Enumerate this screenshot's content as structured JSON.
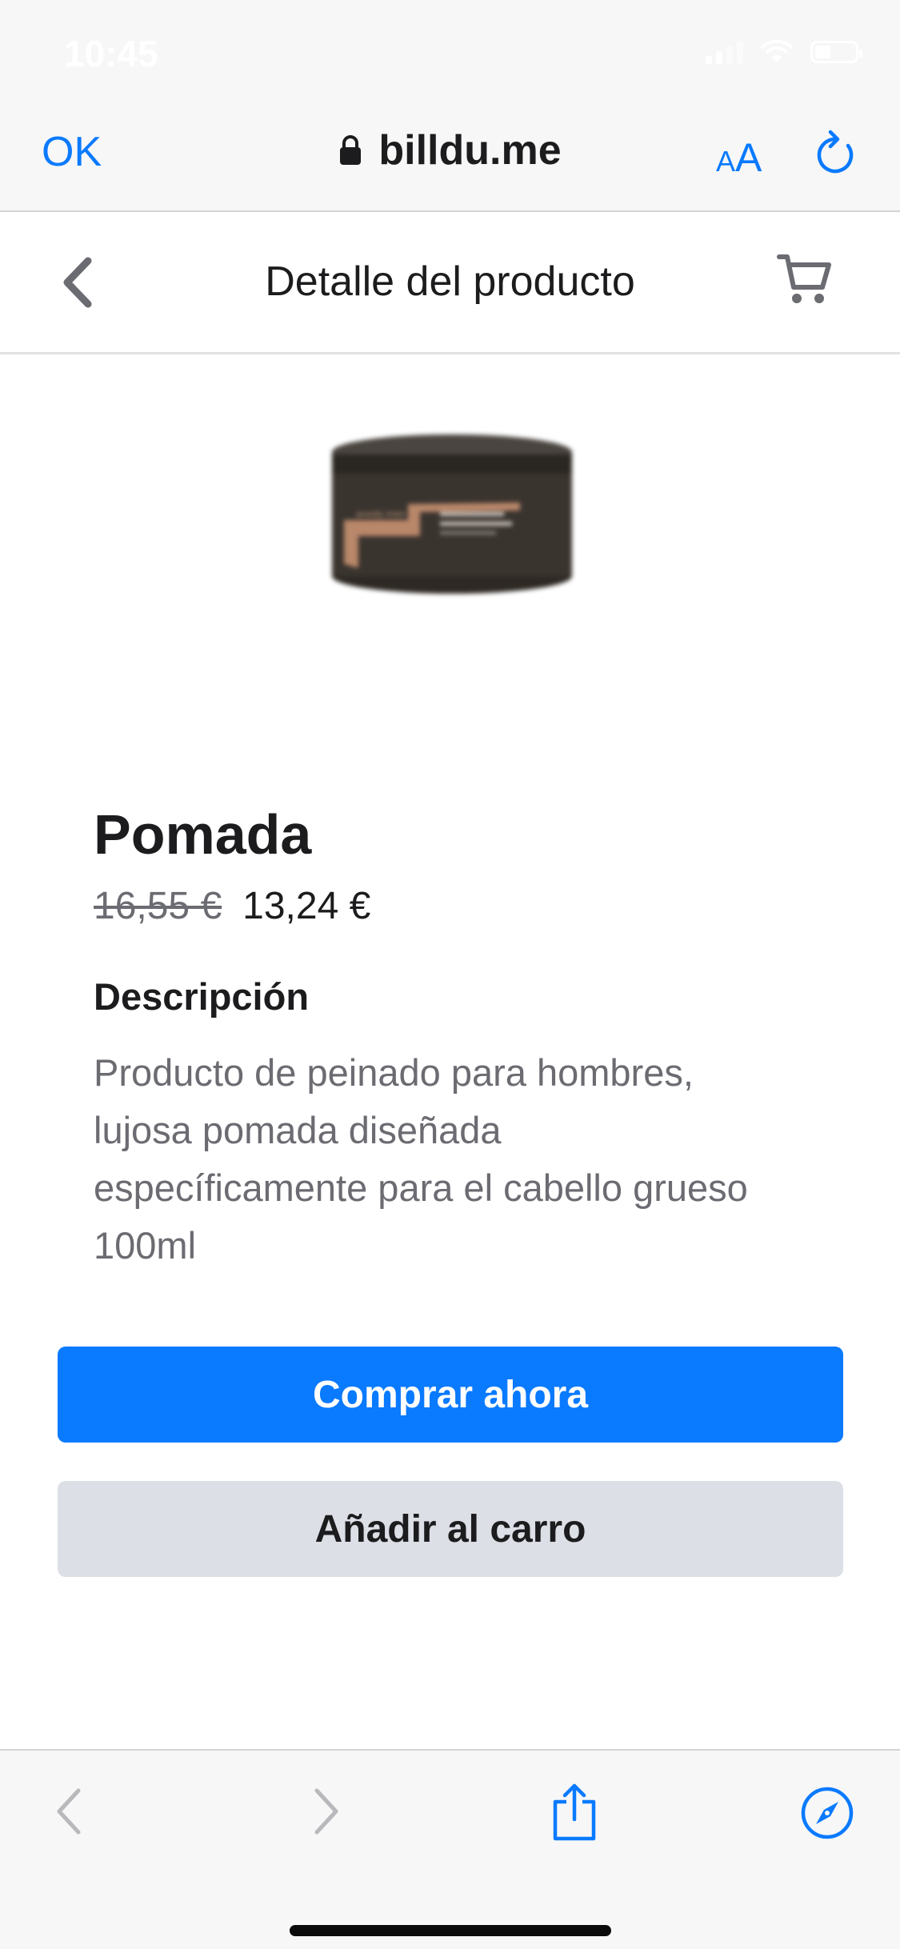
{
  "status_bar": {
    "time": "10:45"
  },
  "browser": {
    "done_label": "OK",
    "url": "billdu.me",
    "text_size_label_small": "A",
    "text_size_label_large": "A"
  },
  "header": {
    "title": "Detalle del producto"
  },
  "product": {
    "name": "Pomada",
    "old_price": "16,55 €",
    "price": "13,24 €",
    "description_heading": "Descripción",
    "description_lines": [
      "Producto de peinado para hombres,",
      "lujosa pomada diseñada",
      "específicamente para el cabello grueso",
      "100ml"
    ],
    "image_label": "aveda men"
  },
  "actions": {
    "buy_now": "Comprar ahora",
    "add_to_cart": "Añadir al carro"
  },
  "icons": {
    "lock": "lock-icon",
    "reload": "reload-icon",
    "back": "chevron-left-icon",
    "cart": "cart-icon",
    "share": "share-icon",
    "compass": "compass-icon"
  },
  "colors": {
    "accent": "#0a7aff",
    "secondary_button": "#dcdfe5"
  }
}
